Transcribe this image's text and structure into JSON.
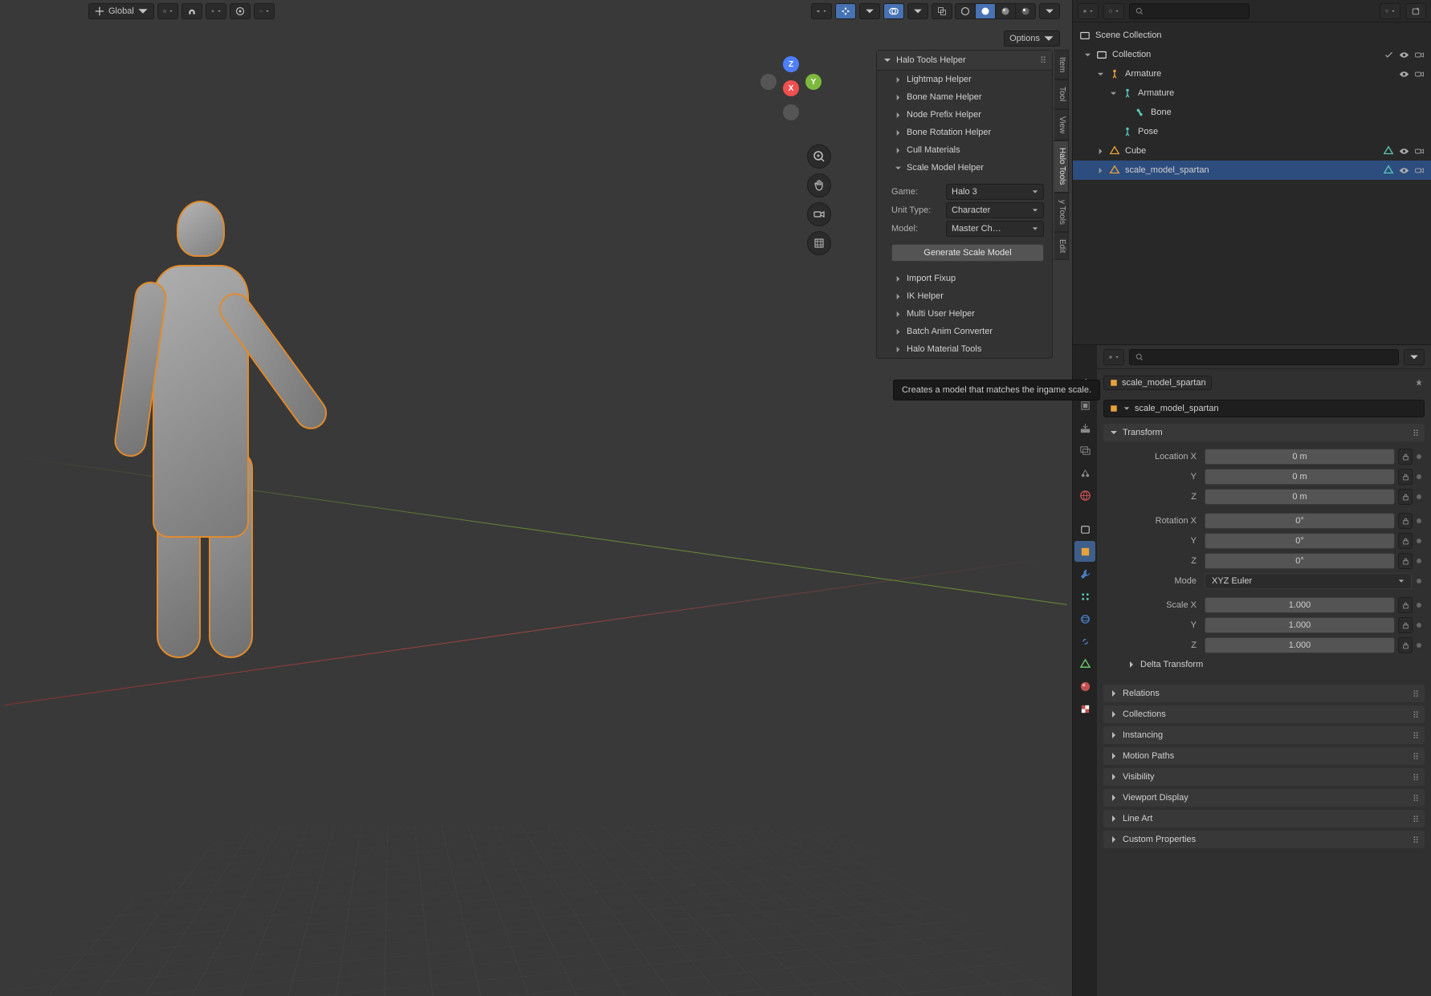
{
  "viewport": {
    "orientation_label": "Global",
    "options_label": "Options",
    "gizmo": {
      "x": "X",
      "y": "Y",
      "z": "Z"
    }
  },
  "npanel": {
    "title": "Halo Tools Helper",
    "sections": [
      "Lightmap Helper",
      "Bone Name Helper",
      "Node Prefix Helper",
      "Bone Rotation Helper",
      "Cull Materials",
      "Scale Model Helper"
    ],
    "scale_model": {
      "game_label": "Game:",
      "game_value": "Halo 3",
      "unit_label": "Unit Type:",
      "unit_value": "Character",
      "model_label": "Model:",
      "model_value": "Master Ch…",
      "button": "Generate Scale Model",
      "tooltip": "Creates a model that matches the ingame scale."
    },
    "sections_after": [
      "Import Fixup",
      "IK Helper",
      "Multi User Helper",
      "Batch Anim Converter",
      "Halo Material Tools"
    ]
  },
  "vtabs": [
    "Item",
    "Tool",
    "View",
    "Halo Tools",
    "y Tools",
    "Edit"
  ],
  "outliner": {
    "header_label": "Scene Collection",
    "rows": [
      {
        "indent": 0,
        "expander": "down",
        "icon": "collection",
        "label": "Collection",
        "icons": [
          "check",
          "eye",
          "camera"
        ]
      },
      {
        "indent": 1,
        "expander": "down",
        "icon": "armature",
        "label": "Armature",
        "icons": [
          "eye",
          "camera"
        ]
      },
      {
        "indent": 2,
        "expander": "down",
        "icon": "armature-data",
        "label": "Armature",
        "icons": []
      },
      {
        "indent": 3,
        "expander": "none",
        "icon": "bone",
        "label": "Bone",
        "icons": []
      },
      {
        "indent": 2,
        "expander": "none",
        "icon": "armature-data",
        "label": "Pose",
        "icons": []
      },
      {
        "indent": 1,
        "expander": "right",
        "icon": "mesh",
        "label": "Cube",
        "icons": [
          "eye",
          "camera"
        ],
        "meshdata": true
      },
      {
        "indent": 1,
        "expander": "right",
        "icon": "mesh",
        "label": "scale_model_spartan",
        "icons": [
          "eye",
          "camera"
        ],
        "selected": true,
        "meshdata": true
      }
    ]
  },
  "properties": {
    "breadcrumb": "scale_model_spartan",
    "name_value": "scale_model_spartan",
    "transform": {
      "title": "Transform",
      "loc_label": "Location X",
      "loc": [
        "0 m",
        "0 m",
        "0 m"
      ],
      "rot_label": "Rotation X",
      "rot": [
        "0°",
        "0°",
        "0°"
      ],
      "mode_label": "Mode",
      "mode_value": "XYZ Euler",
      "scale_label": "Scale X",
      "scale": [
        "1.000",
        "1.000",
        "1.000"
      ],
      "axes": [
        "Y",
        "Z"
      ]
    },
    "panels": [
      "Delta Transform",
      "Relations",
      "Collections",
      "Instancing",
      "Motion Paths",
      "Visibility",
      "Viewport Display",
      "Line Art",
      "Custom Properties"
    ]
  }
}
